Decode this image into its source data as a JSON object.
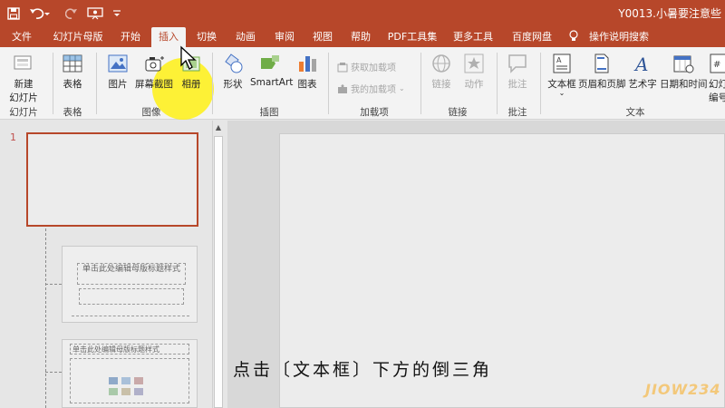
{
  "titlebar": {
    "title": "Y0013.小暑要注意些",
    "quick_access": {
      "save_icon": "save-icon",
      "undo_icon": "undo-icon",
      "redo_icon": "redo-icon",
      "present_icon": "present-icon",
      "customize_icon": "customize-icon"
    }
  },
  "tabs": [
    {
      "label": "文件"
    },
    {
      "label": "幻灯片母版"
    },
    {
      "label": "开始"
    },
    {
      "label": "插入"
    },
    {
      "label": "切换"
    },
    {
      "label": "动画"
    },
    {
      "label": "审阅"
    },
    {
      "label": "视图"
    },
    {
      "label": "PDF工具集"
    },
    {
      "label": "帮助"
    },
    {
      "label": "更多工具"
    },
    {
      "label": "百度网盘"
    },
    {
      "label": "操作说明搜索"
    }
  ],
  "ribbon": {
    "new_slide": {
      "line1": "新建",
      "line2": "幻灯片"
    },
    "table": "表格",
    "pictures": "图片",
    "screenshot": "屏幕截图",
    "album": "相册",
    "shapes": "形状",
    "smartart": "SmartArt",
    "chart": "图表",
    "get_addins": "获取加载项",
    "my_addins": "我的加载项",
    "link": "链接",
    "action": "动作",
    "comment": "批注",
    "textbox": "文本框",
    "header_footer": "页眉和页脚",
    "wordart": "艺术字",
    "datetime": "日期和时间",
    "slide_number": {
      "line1": "幻灯",
      "line2": "编号"
    },
    "groups": {
      "slides": "幻灯片",
      "tables": "表格",
      "images": "图像",
      "illustrations": "插图",
      "addins": "加载项",
      "links": "链接",
      "comments": "批注",
      "text": "文本"
    }
  },
  "thumbnails": {
    "slide_number": "1",
    "layout1_title": "单击此处编辑母版标题样式",
    "layout2_title": "单击此处编辑母版标题样式"
  },
  "subtitle": "点击〔文本框〕下方的倒三角",
  "watermark": "JIOW234",
  "colors": {
    "accent": "#b7472a",
    "highlight": "#fff000"
  }
}
